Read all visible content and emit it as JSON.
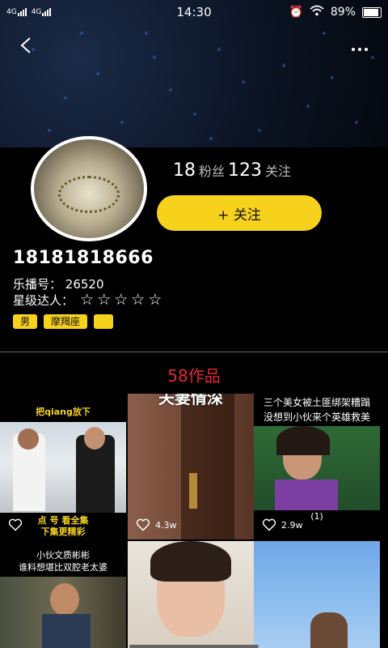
{
  "status": {
    "signal_left": "4G",
    "signal_right": "4G",
    "time": "14:30",
    "battery": "89%"
  },
  "nav": {
    "back_icon": "chevron-left-icon",
    "more_icon": "more-horizontal-icon"
  },
  "profile": {
    "fans_count": "18",
    "fans_label": "粉丝",
    "following_count": "123",
    "following_label": "关注",
    "follow_button": "+ 关注",
    "username": "18181818666",
    "id_label": "乐播号：",
    "id_value": "26520",
    "star_label": "星级达人：",
    "star_rating": 0,
    "star_max": 5,
    "tags": [
      "男",
      "摩羯座",
      ""
    ]
  },
  "works": {
    "title": "58作品"
  },
  "videos": [
    {
      "caption_top": "把qiang放下",
      "caption_bottom": "点 号 看全集\n下集更精彩",
      "likes": "",
      "badge": ""
    },
    {
      "caption_top": "夫妻情深",
      "caption_bottom": "",
      "likes": "4.3w",
      "badge": ""
    },
    {
      "caption_top": "三个美女被土匪绑架糟蹋\n没想到小伙来个英雄救美",
      "caption_bottom": "",
      "likes": "2.9w",
      "badge": "(1)"
    },
    {
      "caption_top": "小伙文质彬彬\n谁料想堪比双腔老太婆",
      "caption_bottom": "",
      "likes": "",
      "badge": ""
    },
    {
      "caption_top": "",
      "caption_bottom": "",
      "likes": "",
      "badge": ""
    },
    {
      "caption_top": "",
      "caption_bottom": "",
      "likes": "",
      "badge": ""
    }
  ],
  "colors": {
    "accent": "#f6d21d",
    "works_title": "#e8262c",
    "background": "#000000"
  }
}
